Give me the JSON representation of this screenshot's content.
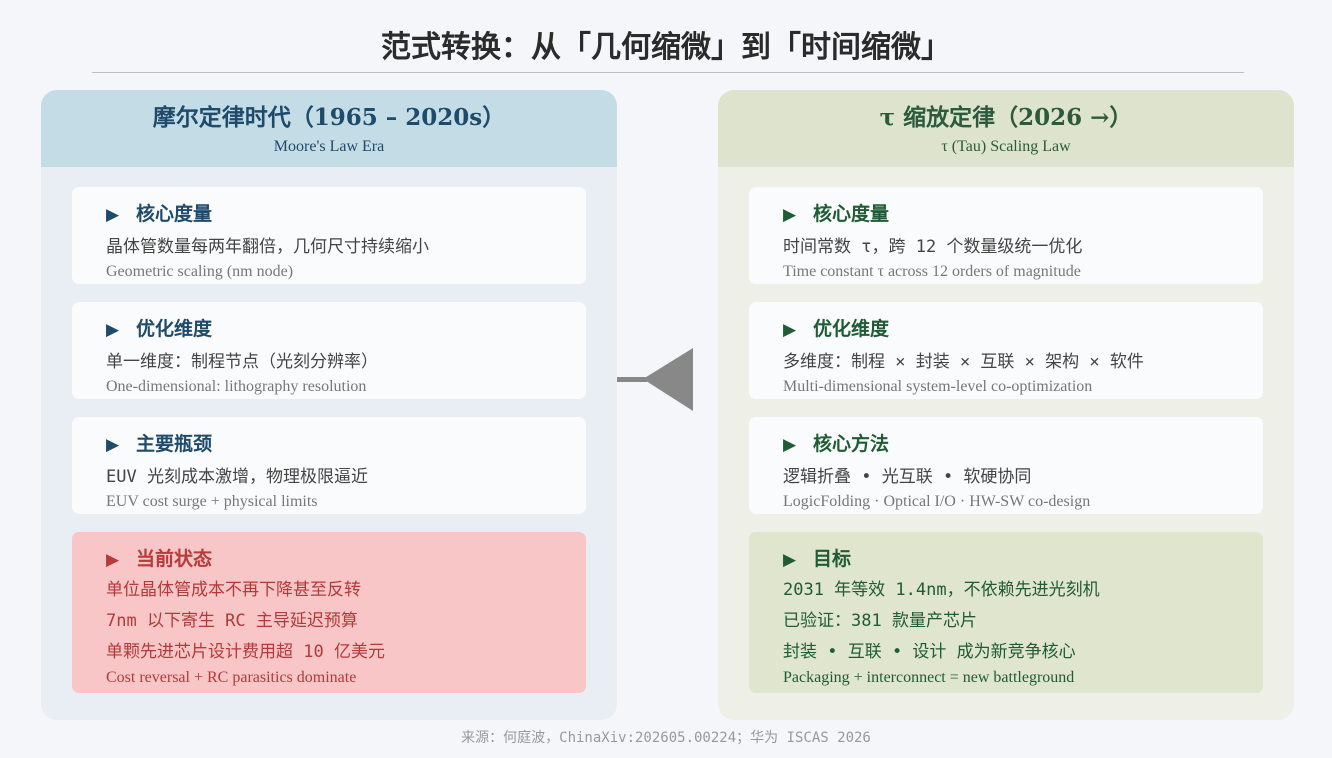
{
  "title": "范式转换：从「几何缩微」到「时间缩微」",
  "left": {
    "title": "摩尔定律时代（1965 – 2020s）",
    "subtitle": "Moore's Law Era",
    "cards": [
      {
        "heading": "核心度量",
        "lines": [
          "晶体管数量每两年翻倍，几何尺寸持续缩小"
        ],
        "en": "Geometric scaling (nm node)"
      },
      {
        "heading": "优化维度",
        "lines": [
          "单一维度：制程节点（光刻分辨率）"
        ],
        "en": "One-dimensional: lithography resolution"
      },
      {
        "heading": "主要瓶颈",
        "lines": [
          "EUV 光刻成本激增，物理极限逼近"
        ],
        "en": "EUV cost surge + physical limits"
      },
      {
        "heading": "当前状态",
        "lines": [
          "单位晶体管成本不再下降甚至反转",
          "7nm 以下寄生 RC 主导延迟预算",
          "单颗先进芯片设计费用超 10 亿美元"
        ],
        "en": "Cost reversal + RC parasitics dominate"
      }
    ]
  },
  "right": {
    "title": "τ  缩放定律（2026 →）",
    "subtitle": "τ (Tau) Scaling Law",
    "cards": [
      {
        "heading": "核心度量",
        "lines": [
          "时间常数 τ，跨 12 个数量级统一优化"
        ],
        "en": "Time constant τ across 12 orders of magnitude"
      },
      {
        "heading": "优化维度",
        "lines": [
          "多维度：制程 × 封装 × 互联 × 架构 × 软件"
        ],
        "en": "Multi-dimensional system-level co-optimization"
      },
      {
        "heading": "核心方法",
        "lines": [
          "逻辑折叠 • 光互联 • 软硬协同"
        ],
        "en": "LogicFolding · Optical I/O · HW-SW co-design"
      },
      {
        "heading": "目标",
        "lines": [
          "2031 年等效 1.4nm，不依赖先进光刻机",
          "已验证：381 款量产芯片",
          "封装 • 互联 • 设计 成为新竞争核心"
        ],
        "en": "Packaging + interconnect = new battleground"
      }
    ]
  },
  "footer": "来源：何庭波，ChinaXiv:202605.00224；华为 ISCAS 2026",
  "colors": {
    "left_accent": "#1e4a6b",
    "right_accent": "#1f5c35",
    "alert": "#b83a3a",
    "arrow": "#888888"
  },
  "icons": {
    "card_marker": "triangle-right-icon",
    "transition": "arrow-left-icon"
  }
}
